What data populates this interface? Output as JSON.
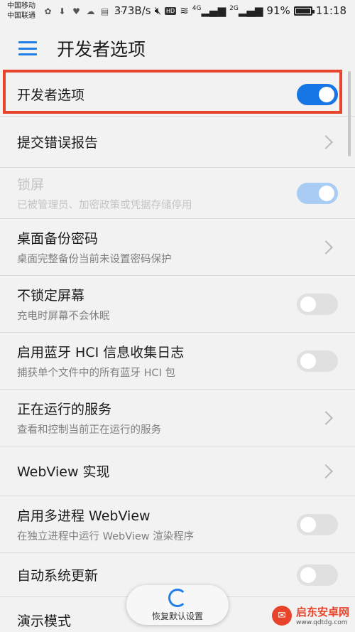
{
  "statusbar": {
    "carrier1": "中国移动",
    "carrier2": "中国联通",
    "speed": "373B/s",
    "net1": "4G",
    "net2": "2G",
    "battery": "91%",
    "battery_level": 0.91,
    "time": "11:18",
    "left_icons": [
      "baidu-icon",
      "download-icon",
      "shield-app-icon",
      "cloud-icon",
      "image-icon",
      "more-dots-icon"
    ]
  },
  "header": {
    "title": "开发者选项"
  },
  "rows": [
    {
      "title": "开发者选项",
      "subtitle": "",
      "control": "toggle-on"
    },
    {
      "title": "提交错误报告",
      "subtitle": "",
      "control": "chevron"
    },
    {
      "title": "锁屏",
      "subtitle": "已被管理员、加密政策或凭据存储停用",
      "control": "toggle-on-disabled"
    },
    {
      "title": "桌面备份密码",
      "subtitle": "桌面完整备份当前未设置密码保护",
      "control": "chevron"
    },
    {
      "title": "不锁定屏幕",
      "subtitle": "充电时屏幕不会休眠",
      "control": "toggle-off"
    },
    {
      "title": "启用蓝牙 HCI 信息收集日志",
      "subtitle": "捕获单个文件中的所有蓝牙 HCI 包",
      "control": "toggle-off"
    },
    {
      "title": "正在运行的服务",
      "subtitle": "查看和控制当前正在运行的服务",
      "control": "chevron"
    },
    {
      "title": "WebView 实现",
      "subtitle": "",
      "control": "chevron"
    },
    {
      "title": "启用多进程 WebView",
      "subtitle": "在独立进程中运行 WebView 渲染程序",
      "control": "toggle-off"
    },
    {
      "title": "自动系统更新",
      "subtitle": "",
      "control": "toggle-off"
    },
    {
      "title": "演示模式",
      "subtitle": "",
      "control": "none"
    }
  ],
  "restore_button": {
    "label": "恢复默认设置"
  },
  "watermark": {
    "name": "启东安卓网",
    "url": "www.qdtdg.com"
  },
  "colors": {
    "accent": "#1776e6",
    "highlight": "#e8442c"
  }
}
